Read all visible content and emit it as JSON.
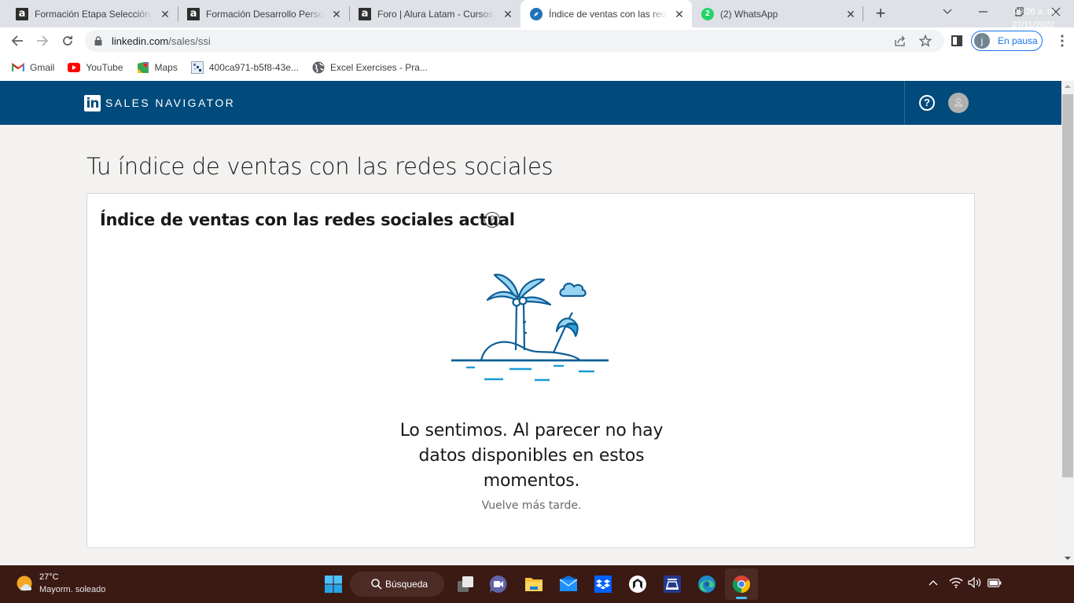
{
  "browser": {
    "tabs": [
      {
        "title": "Formación Etapa Selección: G",
        "icon": "alura-icon",
        "active": false
      },
      {
        "title": "Formación Desarrollo Persona",
        "icon": "alura-icon",
        "active": false
      },
      {
        "title": "Foro | Alura Latam - Cursos o",
        "icon": "alura-icon",
        "active": false
      },
      {
        "title": "Índice de ventas con las rede",
        "icon": "sales-navigator-compass-icon",
        "active": true
      },
      {
        "title": "(2) WhatsApp",
        "icon": "whatsapp-icon",
        "active": false,
        "badge": "2"
      }
    ],
    "new_tab_label": "+",
    "url_domain": "linkedin.com",
    "url_path": "/sales/ssi",
    "profile_initial": "j",
    "profile_status": "En pausa",
    "bookmarks": [
      {
        "label": "Gmail",
        "icon": "gmail-icon"
      },
      {
        "label": "YouTube",
        "icon": "youtube-icon"
      },
      {
        "label": "Maps",
        "icon": "maps-icon"
      },
      {
        "label": "400ca971-b5f8-43e...",
        "icon": "image-file-icon"
      },
      {
        "label": "Excel Exercises - Pra...",
        "icon": "globe-icon"
      }
    ]
  },
  "app": {
    "logo_text": "in",
    "brand": "SALES NAVIGATOR",
    "help_glyph": "?"
  },
  "page": {
    "title": "Tu índice de ventas con las redes sociales",
    "card": {
      "title": "Índice de ventas con las redes sociales actual",
      "help_glyph": "?",
      "empty_message": "Lo sentimos. Al parecer no hay datos disponibles en estos momentos.",
      "empty_sub": "Vuelve más tarde."
    }
  },
  "colors": {
    "linkedin_header": "#004b7c",
    "illustration_stroke": "#0e5e95",
    "illustration_fill": "#98d4f2",
    "water_lines": "#1a9bd7"
  },
  "taskbar": {
    "weather_temp": "27°C",
    "weather_desc": "Mayorm. soleado",
    "search_label": "Búsqueda",
    "time": "09:26 a. m.",
    "date": "27/11/2022"
  }
}
